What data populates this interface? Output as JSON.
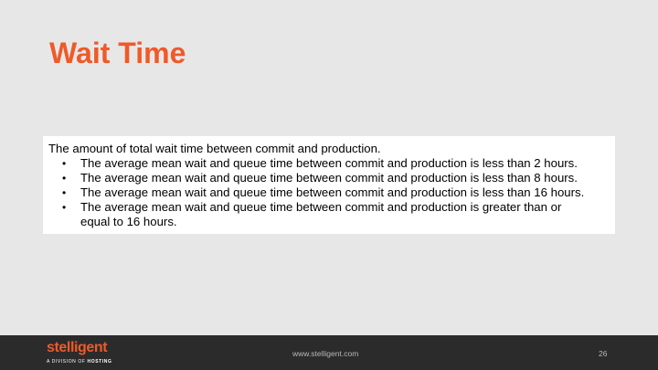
{
  "slide": {
    "title": "Wait Time",
    "intro": "The amount of total wait time between commit and production.",
    "bullet_glyph": "•",
    "bullets": [
      "The average mean wait and queue time between commit and production is less than 2 hours.",
      "The average mean wait and queue time between commit and production is less than 8 hours.",
      "The average mean wait and queue time between commit and production is less than 16 hours.",
      "The average mean wait and queue time between commit and production is greater than or equal to 16 hours."
    ]
  },
  "footer": {
    "logo_main": "stelligent",
    "logo_sub_prefix": "A DIVISION OF ",
    "logo_sub_brand": "HOSTING",
    "url": "www.stelligent.com",
    "page_number": "26"
  },
  "colors": {
    "title": "#ef5a28",
    "slide_background": "#e7e7e8",
    "footer_background": "#2b2b2c",
    "content_background": "#ffffff"
  }
}
